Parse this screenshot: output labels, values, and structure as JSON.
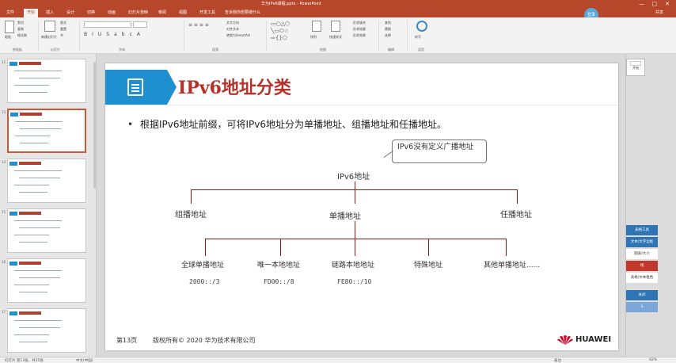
{
  "window": {
    "title": "华为IPv6课程.pptx - PowerPoint",
    "minimize": "—",
    "maximize": "□",
    "close": "✕"
  },
  "tabs": [
    "文件",
    "开始",
    "插入",
    "设计",
    "切换",
    "动画",
    "幻灯片放映",
    "审阅",
    "视图",
    "开发工具",
    "告诉我你想要做什么"
  ],
  "active_tab": "开始",
  "user": {
    "name": "登录"
  },
  "share_label": "共享",
  "ribbon": {
    "groups": [
      "剪贴板",
      "幻灯片",
      "字体",
      "段落",
      "绘图",
      "编辑",
      "语音"
    ],
    "buttons": [
      "粘贴",
      "剪切",
      "复制",
      "格式刷",
      "新建幻灯片",
      "版式",
      "重置",
      "节",
      "文字方向",
      "对齐文本",
      "转换为SmartArt",
      "排列",
      "快速样式",
      "形状填充",
      "形状轮廓",
      "形状效果",
      "查找",
      "替换",
      "选择",
      "听写"
    ]
  },
  "thumbnails": [
    {
      "num": "12",
      "selected": false
    },
    {
      "num": "13",
      "selected": true
    },
    {
      "num": "14",
      "selected": false
    },
    {
      "num": "15",
      "selected": false
    },
    {
      "num": "16",
      "selected": false
    },
    {
      "num": "17",
      "selected": false
    }
  ],
  "slide": {
    "title": "IPv6地址分类",
    "bullet": "•",
    "bullet_text": "根据IPv6地址前缀，可将IPv6地址分为单播地址、组播地址和任播地址。",
    "callout": "IPv6没有定义广播地址",
    "root": "IPv6地址",
    "level1": [
      "组播地址",
      "单播地址",
      "任播地址"
    ],
    "level2": [
      "全球单播地址",
      "唯一本地地址",
      "链路本地地址",
      "特殊地址",
      "其他单播地址......"
    ],
    "prefixes": [
      "2000::/3",
      "FD00::/8",
      "FE80::/10"
    ],
    "footer_page": "第13页",
    "footer_copyright": "版权所有© 2020 华为技术有限公司",
    "brand": "HUAWEI"
  },
  "right_panel": {
    "top_label": "开始",
    "items": [
      {
        "label": "表格工具",
        "bg": "#2e75b6",
        "fg": "#ffffff"
      },
      {
        "label": "文本/文字边框",
        "bg": "#2e75b6",
        "fg": "#ffffff"
      },
      {
        "label": "图表/大小",
        "bg": "#ffffff",
        "fg": "#333333"
      },
      {
        "label": "线",
        "bg": "#c0392b",
        "fg": "#ffffff"
      },
      {
        "label": "表格/文本框色",
        "bg": "#ffffff",
        "fg": "#333333"
      },
      {
        "label": "关闭",
        "bg": "#2e75b6",
        "fg": "#ffffff"
      },
      {
        "label": "S",
        "bg": "#7aa7d8",
        "fg": "#ffffff"
      }
    ]
  },
  "statusbar": {
    "slide_info": "幻灯片 第13张，共35张",
    "language": "中文(中国)",
    "notes": "备注",
    "zoom": "92%"
  },
  "colors": {
    "ribbon_accent": "#b7472a",
    "title_red": "#b5322a",
    "header_blue": "#1e90d0",
    "tree_line": "#8b1a10"
  }
}
